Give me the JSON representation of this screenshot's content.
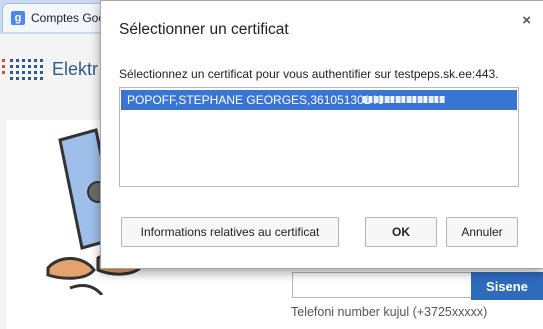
{
  "browser": {
    "tab_title": "Comptes Goo",
    "tab_favicon": "g",
    "window_close_icon": "x"
  },
  "site": {
    "name": "Elektr",
    "phone_label": "Telefoni number kujul (+3725xxxxx)",
    "phone_value": "",
    "submit_label": "Sisene"
  },
  "dialog": {
    "title": "Sélectionner un certificat",
    "message": "Sélectionnez un certificat pour vous authentifier sur testpeps.sk.ee:443.",
    "certificates": [
      {
        "text": "POPOFF,STEPHANE GEORGES,36105130146",
        "selected": true
      }
    ],
    "buttons": {
      "info": "Informations relatives au certificat",
      "ok": "OK",
      "cancel": "Annuler"
    },
    "close_icon": "×"
  },
  "colors": {
    "accent": "#3a75d3",
    "button_blue": "#2f6bbd"
  }
}
